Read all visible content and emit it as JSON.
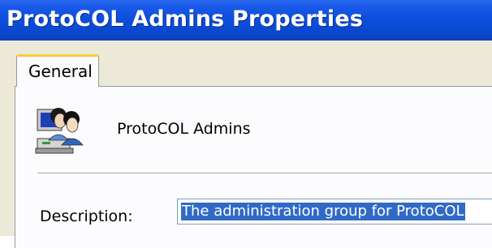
{
  "window": {
    "title": "ProtoCOL Admins Properties"
  },
  "tabs": [
    {
      "label": "General",
      "selected": true
    }
  ],
  "general": {
    "group_name": "ProtoCOL Admins",
    "icon": "user-group-icon",
    "description_label": "Description:",
    "description_value": "The administration group for ProtoCOL",
    "description_selected": true
  },
  "colors": {
    "titlebar": "#0a47cf",
    "tab_highlight": "#ffc83c",
    "selection": "#316ac5",
    "dialog_bg": "#ece9d8"
  }
}
